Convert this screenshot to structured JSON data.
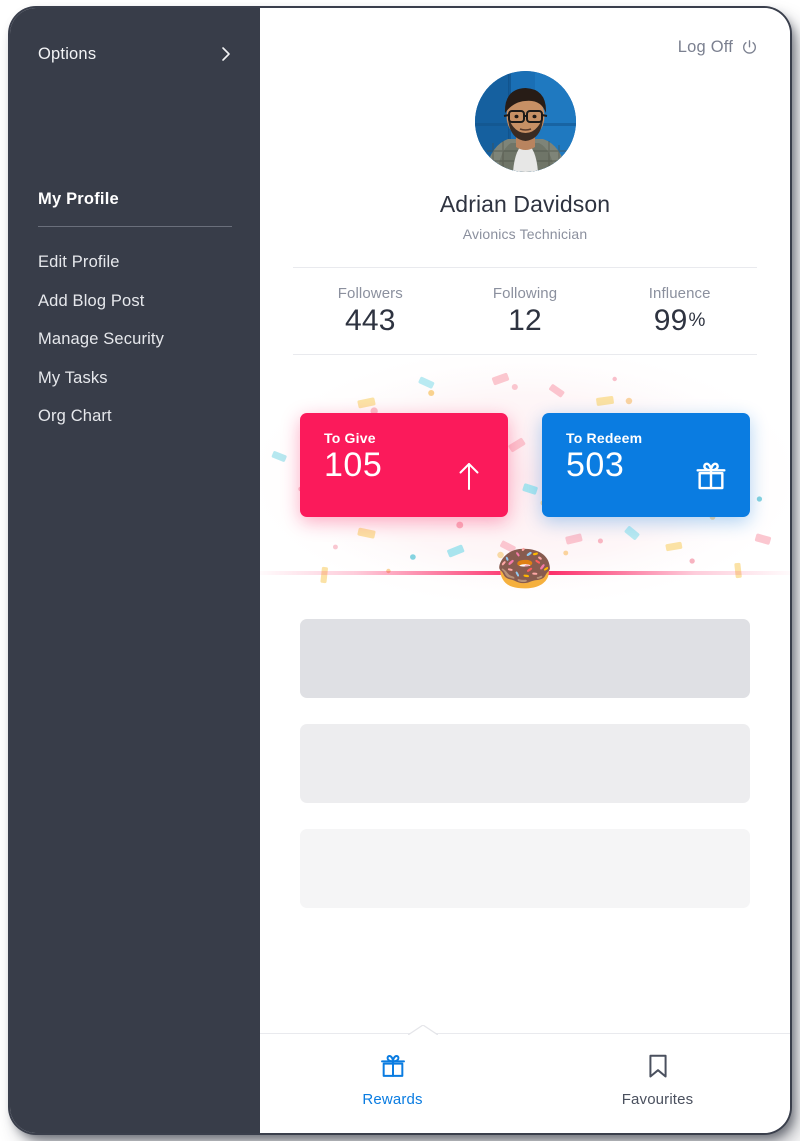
{
  "sidebar": {
    "options_label": "Options",
    "options_chevron_icon": "chevron-right-icon",
    "section_title": "My Profile",
    "menu": [
      {
        "label": "Edit Profile"
      },
      {
        "label": "Add Blog Post"
      },
      {
        "label": "Manage Security"
      },
      {
        "label": "My Tasks"
      },
      {
        "label": "Org Chart"
      }
    ],
    "background_color": "#383d49"
  },
  "header": {
    "logoff_label": "Log Off",
    "logoff_icon": "power-icon"
  },
  "profile": {
    "avatar_icon": "user-avatar-photo",
    "name": "Adrian Davidson",
    "role": "Avionics Technician"
  },
  "stats": [
    {
      "label": "Followers",
      "value": "443",
      "suffix": ""
    },
    {
      "label": "Following",
      "value": "12",
      "suffix": ""
    },
    {
      "label": "Influence",
      "value": "99",
      "suffix": "%"
    }
  ],
  "reward_cards": [
    {
      "label": "To Give",
      "value": "105",
      "icon": "arrow-up-icon",
      "color": "#fb1a5b"
    },
    {
      "label": "To Redeem",
      "value": "503",
      "icon": "gift-icon",
      "color": "#0a7ce1"
    }
  ],
  "divider": {
    "donut_icon": "🍩",
    "line_color": "#fb1a5b"
  },
  "skeleton_items": [
    {
      "shade": "sk1"
    },
    {
      "shade": "sk2"
    },
    {
      "shade": "sk3"
    }
  ],
  "tabs": [
    {
      "label": "Rewards",
      "icon": "gift-icon",
      "active": true,
      "color": "#0a7ce1"
    },
    {
      "label": "Favourites",
      "icon": "bookmark-icon",
      "active": false,
      "color": "#4a505e"
    }
  ]
}
